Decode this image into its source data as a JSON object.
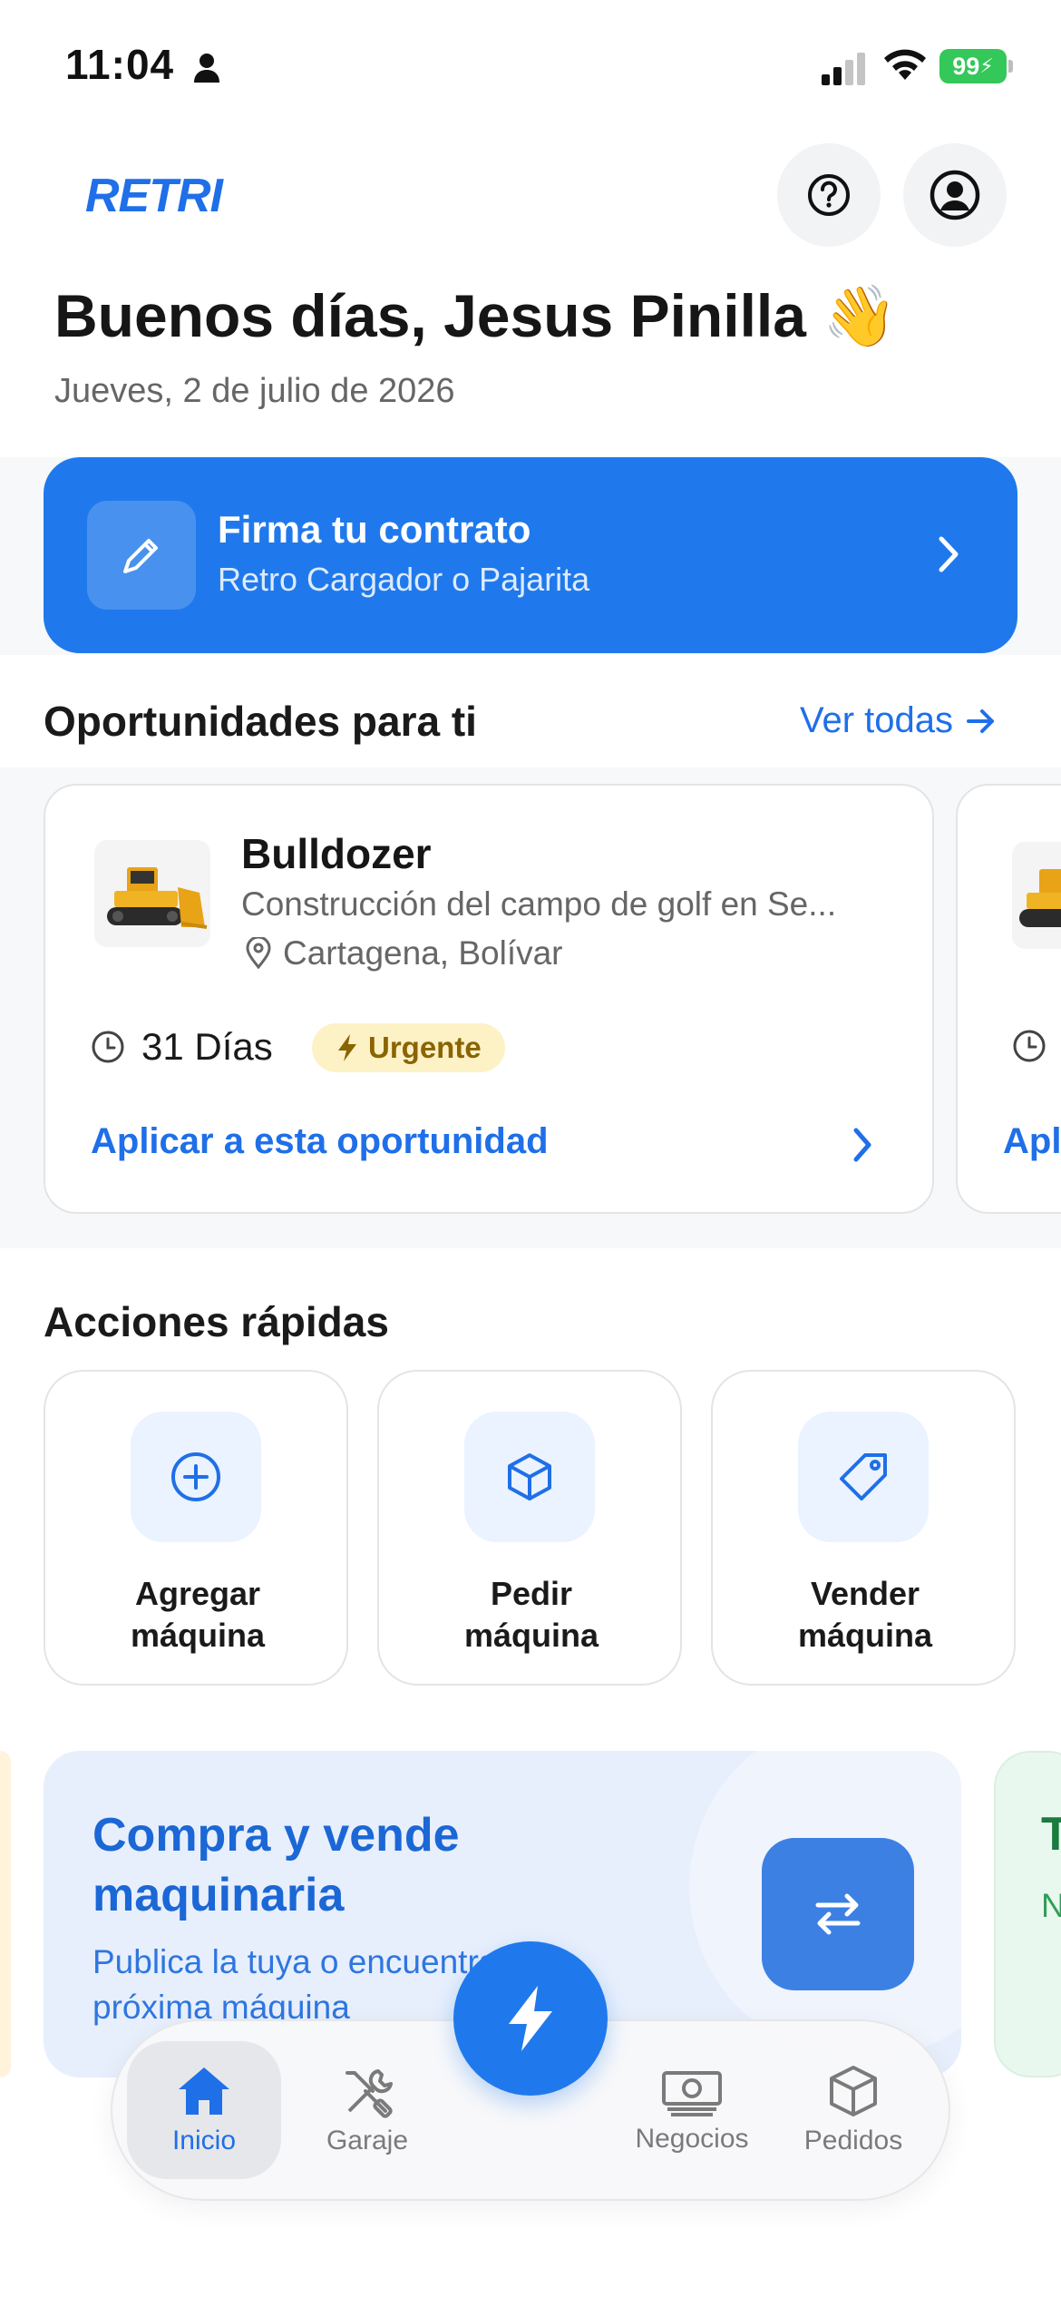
{
  "status_bar": {
    "time": "11:04",
    "battery": "99"
  },
  "header": {
    "logo": "RETRI"
  },
  "greeting": {
    "title": "Buenos días, Jesus Pinilla 👋",
    "date": "Jueves, 2 de julio de 2026"
  },
  "contract": {
    "title": "Firma tu contrato",
    "subtitle": "Retro Cargador o Pajarita"
  },
  "opportunities": {
    "section_title": "Oportunidades para ti",
    "see_all": "Ver todas",
    "cards": [
      {
        "title": "Bulldozer",
        "description": "Construcción del campo de golf en Se...",
        "location": "Cartagena, Bolívar",
        "duration": "31 Días",
        "badge": "Urgente",
        "apply": "Aplicar a esta oportunidad"
      },
      {
        "duration": "(",
        "apply": "Apl"
      }
    ]
  },
  "quick_actions": {
    "section_title": "Acciones rápidas",
    "items": [
      {
        "line1": "Agregar",
        "line2": "máquina",
        "icon": "plus-circle-icon"
      },
      {
        "line1": "Pedir",
        "line2": "máquina",
        "icon": "box-icon"
      },
      {
        "line1": "Vender",
        "line2": "máquina",
        "icon": "tag-icon"
      }
    ]
  },
  "promo": {
    "title_line1": "Compra y vende",
    "title_line2": "maquinaria",
    "subtitle_line1": "Publica la tuya o encuentra tu",
    "subtitle_line2": "próxima máquina",
    "next_peek_letter": "T",
    "next_peek_sub": "N"
  },
  "tabbar": {
    "items": [
      {
        "label": "Inicio",
        "icon": "home-icon",
        "active": true
      },
      {
        "label": "Garaje",
        "icon": "tools-icon",
        "active": false
      },
      {
        "label": "Negocios",
        "icon": "banknote-icon",
        "active": false
      },
      {
        "label": "Pedidos",
        "icon": "box-icon",
        "active": false
      }
    ]
  },
  "colors": {
    "primary": "#2079ec",
    "accent_text": "#1f6fe8",
    "badge_bg": "#fdf1c6",
    "badge_text": "#8a6400"
  }
}
